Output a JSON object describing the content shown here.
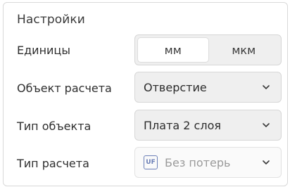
{
  "panel": {
    "title": "Настройки"
  },
  "units": {
    "label": "Единицы",
    "options": [
      "мм",
      "мкм"
    ],
    "selected": "мм"
  },
  "calc_object": {
    "label": "Объект расчета",
    "value": "Отверстие"
  },
  "object_type": {
    "label": "Тип объекта",
    "value": "Плата 2 слоя"
  },
  "calc_type": {
    "label": "Тип расчета",
    "value": "Без потерь",
    "icon": "uf-icon",
    "icon_text": "UF",
    "disabled": true
  },
  "colors": {
    "accent_icon": "#6b7fb7",
    "control_bg": "#efefef",
    "border": "#d7d7d7"
  }
}
